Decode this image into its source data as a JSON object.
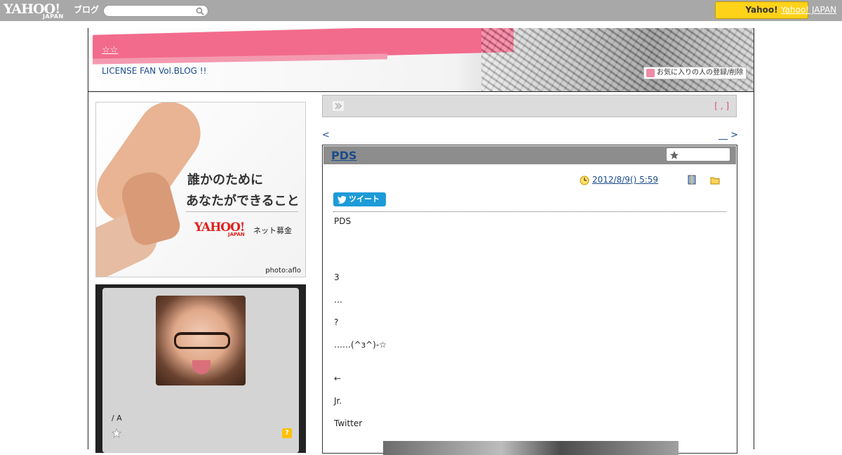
{
  "topbar": {
    "logo_yahoo": "YAHOO!",
    "logo_japan": "JAPAN",
    "logo_blog": "ブログ",
    "search_value": "",
    "yahoo_button": "Yahoo!",
    "yahoo_japan_link": "Yahoo! JAPAN"
  },
  "header": {
    "stars": "☆☆",
    "subtitle": "LICENSE FAN Vol.BLOG !!",
    "favorite_button": "お気に入りの人の登録/削除"
  },
  "ad": {
    "line1": "誰かのために",
    "line2": "あなたができること",
    "yahoo": "YAHOO!",
    "yahoo_japan": "JAPAN",
    "service": "ネット募金",
    "credit": "photo:aflo"
  },
  "profile": {
    "name": "/ A",
    "help": "?"
  },
  "notice": {
    "bracket": "[ , ]"
  },
  "nav": {
    "prev": "<",
    "next": "__ >"
  },
  "entry": {
    "title": "PDS",
    "date": "2012/8/9()  5:59    ",
    "tweet_label": "ツイート",
    "body": [
      "PDS",
      "3",
      "…",
      "?",
      "……(^ɜ^)-☆",
      "←",
      "Jr.",
      "Twitter"
    ]
  },
  "colors": {
    "topbar": "#a8a8a8",
    "accent_pink": "#f26b8c",
    "link_blue": "#1a4c8a",
    "entry_header": "#8d8d8d",
    "tweet_blue": "#1d9bd8",
    "yahoo_yellow": "#ffd21a"
  },
  "icons": [
    "search-icon",
    "heart-icon",
    "arrow-icon",
    "star-icon",
    "clock-icon",
    "book-icon",
    "folder-icon",
    "bird-icon",
    "help-icon"
  ]
}
